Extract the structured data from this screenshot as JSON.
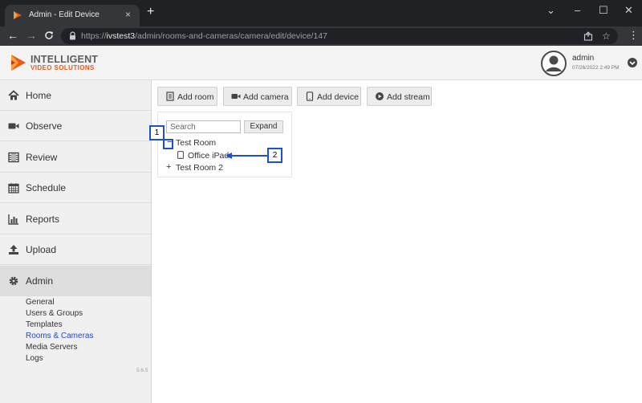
{
  "browser": {
    "tab_title": "Admin - Edit Device",
    "tab_close": "×",
    "new_tab": "+",
    "url_scheme": "https://",
    "url_host": "ivstest3",
    "url_path": "/admin/rooms-and-cameras/camera/edit/device/147",
    "window_controls": [
      "⌄",
      "–",
      "☐",
      "✕"
    ]
  },
  "header": {
    "logo_line1": "INTELLIGENT",
    "logo_line2": "VIDEO SOLUTIONS",
    "user_name": "admin",
    "user_time": "07/26/2022 2:49 PM",
    "brand_color": "#e8591a"
  },
  "sidebar": {
    "items": [
      {
        "label": "Home",
        "icon": "home-icon"
      },
      {
        "label": "Observe",
        "icon": "video-camera-icon"
      },
      {
        "label": "Review",
        "icon": "film-icon"
      },
      {
        "label": "Schedule",
        "icon": "calendar-icon"
      },
      {
        "label": "Reports",
        "icon": "bar-chart-icon"
      },
      {
        "label": "Upload",
        "icon": "upload-icon"
      },
      {
        "label": "Admin",
        "icon": "gear-icon",
        "active": true
      }
    ],
    "admin_subitems": [
      "General",
      "Users & Groups",
      "Templates",
      "Rooms & Cameras",
      "Media Servers",
      "Logs"
    ],
    "current_subitem": "Rooms & Cameras",
    "version": "5.6.5",
    "link_color": "#1f48d9"
  },
  "toolbar": {
    "add_room": "Add room",
    "add_camera": "Add camera",
    "add_device": "Add device",
    "add_stream": "Add stream"
  },
  "tree": {
    "search_placeholder": "Search",
    "expand_label": "Expand",
    "nodes": [
      {
        "toggle": "−",
        "label": "Test Room",
        "expanded": true,
        "children": [
          {
            "label": "Office iPad",
            "icon": "tablet-icon"
          }
        ]
      },
      {
        "toggle": "+",
        "label": "Test Room 2",
        "expanded": false
      }
    ]
  },
  "annotations": {
    "callout_1": "1",
    "callout_2": "2",
    "color": "#1a4fd6"
  }
}
